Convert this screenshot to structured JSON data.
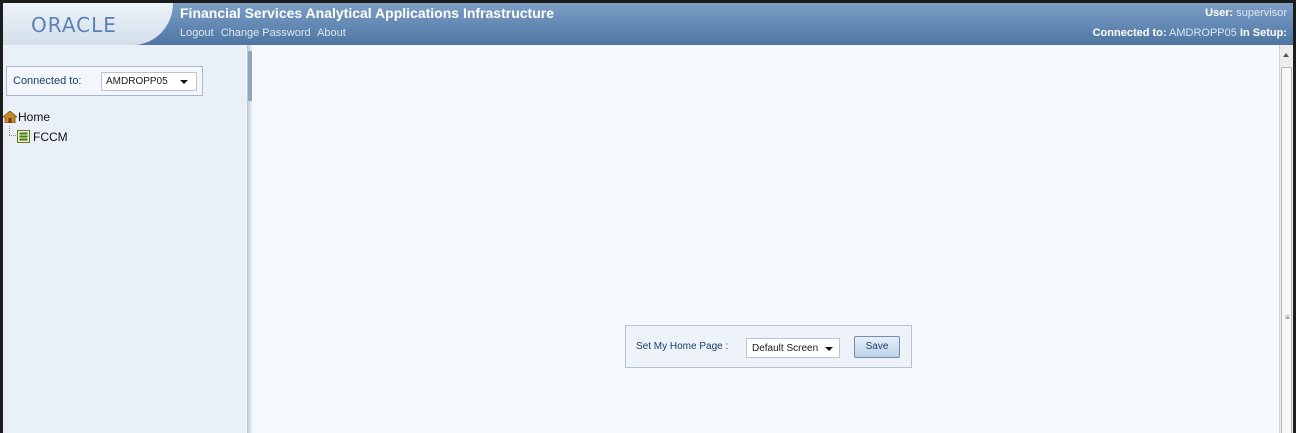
{
  "header": {
    "logo": "ORACLE",
    "app_title": "Financial Services Analytical Applications Infrastructure",
    "links": {
      "logout": "Logout",
      "change_password": "Change Password",
      "about": "About"
    },
    "user_label": "User:",
    "user_value": "supervisor",
    "connected_label": "Connected to:",
    "connected_value": "AMDROPP05",
    "in_setup_label": "In Setup:"
  },
  "sidebar": {
    "connected_label": "Connected to:",
    "connected_selected": "AMDROPP05",
    "tree": {
      "root": "Home",
      "children": [
        "FCCM"
      ]
    }
  },
  "main": {
    "home_page_label": "Set My Home Page :",
    "home_page_selected": "Default Screen",
    "save_label": "Save"
  },
  "colors": {
    "header_blue": "#6288b3",
    "sidebar_bg": "#e9f0f8",
    "label_blue": "#1a3f6e"
  },
  "icons": {
    "home": "home-icon",
    "fccm": "fccm-node-icon",
    "dropdown": "chevron-down-icon"
  }
}
